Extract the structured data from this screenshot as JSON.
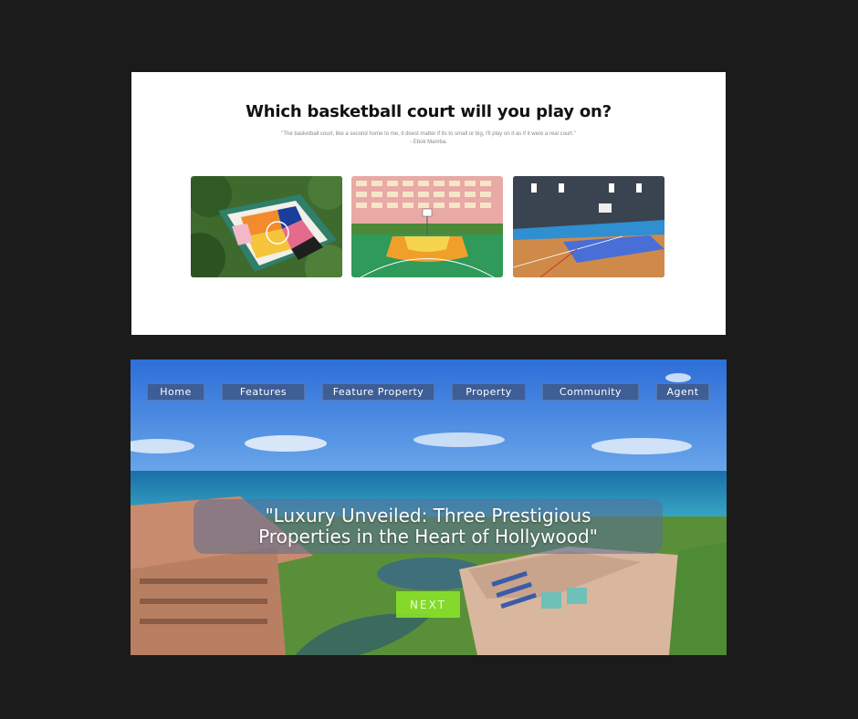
{
  "basketball": {
    "title": "Which basketball court will you play on?",
    "quote_line1": "\"The basketball court, like a second home to me, it doest matter if its to small or big, I'll play on it as if it were a real court.\"",
    "quote_line2": "- Ebok Mamba.",
    "courts": [
      {
        "icon": "outdoor-colorful-court-image"
      },
      {
        "icon": "urban-court-image"
      },
      {
        "icon": "indoor-court-image"
      }
    ]
  },
  "hero": {
    "nav": [
      "Home",
      "Features",
      "Feature Property",
      "Property",
      "Community",
      "Agent"
    ],
    "headline_line1": "\"Luxury Unveiled: Three Prestigious",
    "headline_line2": "Properties in the Heart of Hollywood\"",
    "next_label": "NEXT",
    "accent": "#8ce628"
  }
}
